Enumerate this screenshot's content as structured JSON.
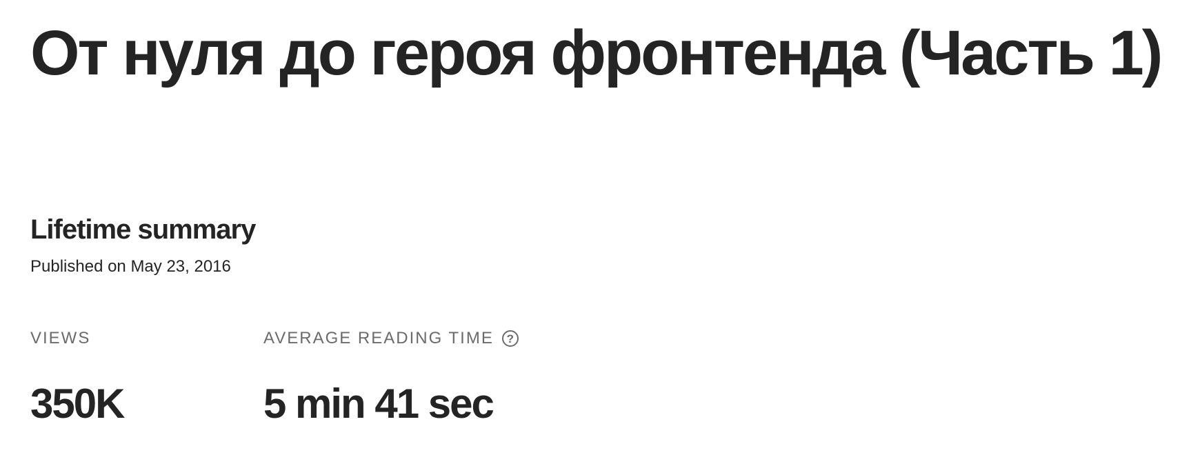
{
  "story": {
    "title": "От нуля до героя фронтенда (Часть 1)"
  },
  "summary": {
    "heading": "Lifetime summary",
    "published": "Published on May 23, 2016"
  },
  "stats": {
    "views": {
      "label": "VIEWS",
      "value": "350K"
    },
    "reading_time": {
      "label": "AVERAGE READING TIME",
      "value": "5 min 41 sec",
      "help_icon": "question-circle-icon"
    }
  },
  "colors": {
    "text": "#242424",
    "muted": "#6b6b6b",
    "background": "#ffffff"
  }
}
